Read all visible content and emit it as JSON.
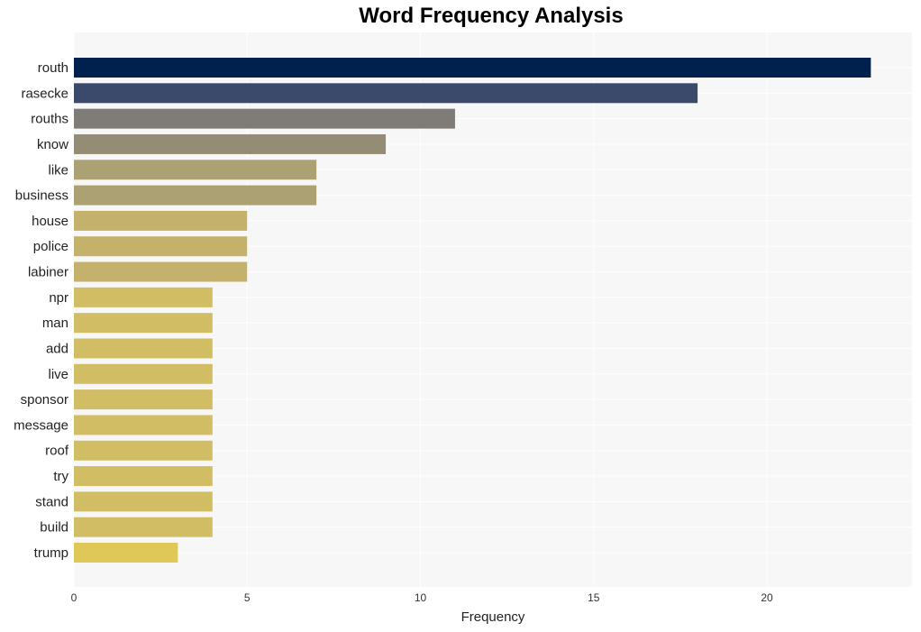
{
  "chart_data": {
    "type": "bar",
    "orientation": "horizontal",
    "title": "Word Frequency Analysis",
    "xlabel": "Frequency",
    "ylabel": "",
    "xlim": [
      0,
      24.2
    ],
    "xticks": [
      0,
      5,
      10,
      15,
      20
    ],
    "grid": true,
    "legend": "none",
    "categories": [
      "routh",
      "rasecke",
      "rouths",
      "know",
      "like",
      "business",
      "house",
      "police",
      "labiner",
      "npr",
      "man",
      "add",
      "live",
      "sponsor",
      "message",
      "roof",
      "try",
      "stand",
      "build",
      "trump"
    ],
    "values": [
      23,
      18,
      11,
      9,
      7,
      7,
      5,
      5,
      5,
      4,
      4,
      4,
      4,
      4,
      4,
      4,
      4,
      4,
      4,
      3
    ],
    "colors": [
      "#00214e",
      "#3b4a6b",
      "#7f7c78",
      "#948c74",
      "#aca173",
      "#aca173",
      "#c4b16b",
      "#c4b16b",
      "#c4b16b",
      "#d1bd64",
      "#d1bd64",
      "#d1bd64",
      "#d1bd64",
      "#d1bd64",
      "#d1bd64",
      "#d1bd64",
      "#d1bd64",
      "#d1bd64",
      "#d1bd64",
      "#dfc857"
    ]
  }
}
